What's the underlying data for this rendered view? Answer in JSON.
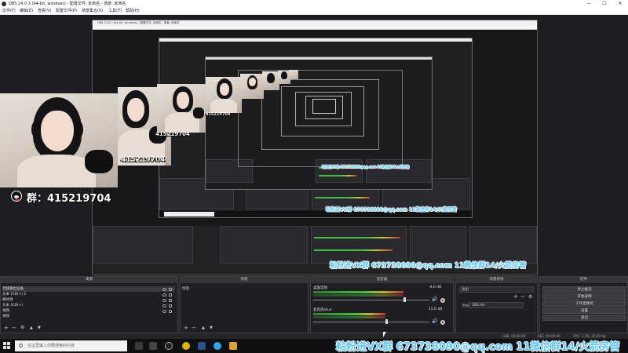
{
  "window": {
    "title": "OBS 24.0.3 (64-bit, windows) - 配置文件: 未命名 - 场景: 未命名",
    "controls": [
      "—",
      "☐",
      "✕"
    ]
  },
  "menu": [
    "文件(F)",
    "编辑(E)",
    "查看(V)",
    "配置文件(P)",
    "场景集合(S)",
    "工具(T)",
    "帮助(H)"
  ],
  "nested_title": "OBS 24.0.3 (64-bit, windows) - 配置文件: 未命名 - 场景: 未命名",
  "overlay": {
    "group_main": "群：415219704",
    "group_small": "415219704",
    "banner_main": "粘粉进VX群 673738090@qq.com 11微信群14/火箭房管",
    "banner_mid": "粘粉进VX群 673738090@qq.com 11微信群14/火箭房管",
    "banner_small": "粘粉进VX群 673738090@qq.com 11微信群14/火箭房管"
  },
  "docks": {
    "scenes": {
      "header": "来源",
      "items": [
        "音频输出设备",
        "文本 (GDI+) 2",
        "媒体源",
        "文本 (GDI+)",
        "视频",
        "视频"
      ]
    },
    "sources": {
      "header": "场景",
      "items": [
        "场景"
      ]
    },
    "mixer": {
      "header": "混音器",
      "channels": [
        {
          "name": "桌面音频",
          "db": "-4.6 dB",
          "level": 0.78
        },
        {
          "name": "麦克风/Aux",
          "db": "15.0 dB",
          "level": 0.62
        }
      ]
    },
    "transitions": {
      "header": "场景转场",
      "selected": "淡出",
      "duration_label": "时长",
      "duration_value": "300 ms"
    },
    "controls": {
      "header": "控件",
      "buttons": [
        "停止推流",
        "开始录制",
        "工作室模式",
        "设置",
        "退出"
      ]
    }
  },
  "status": {
    "live": "LIVE: 00:00:00",
    "rec": "REC: 00:00:00",
    "cpu": "CPU: 1.2%, 30.00 fps"
  },
  "taskbar": {
    "search_placeholder": "在这里输入你要搜索的内容"
  },
  "colors": {
    "accent_meter_green": "#3fbf3f",
    "overlay_blue": "#5ec8ff",
    "dock_bg": "#1f1f23"
  }
}
